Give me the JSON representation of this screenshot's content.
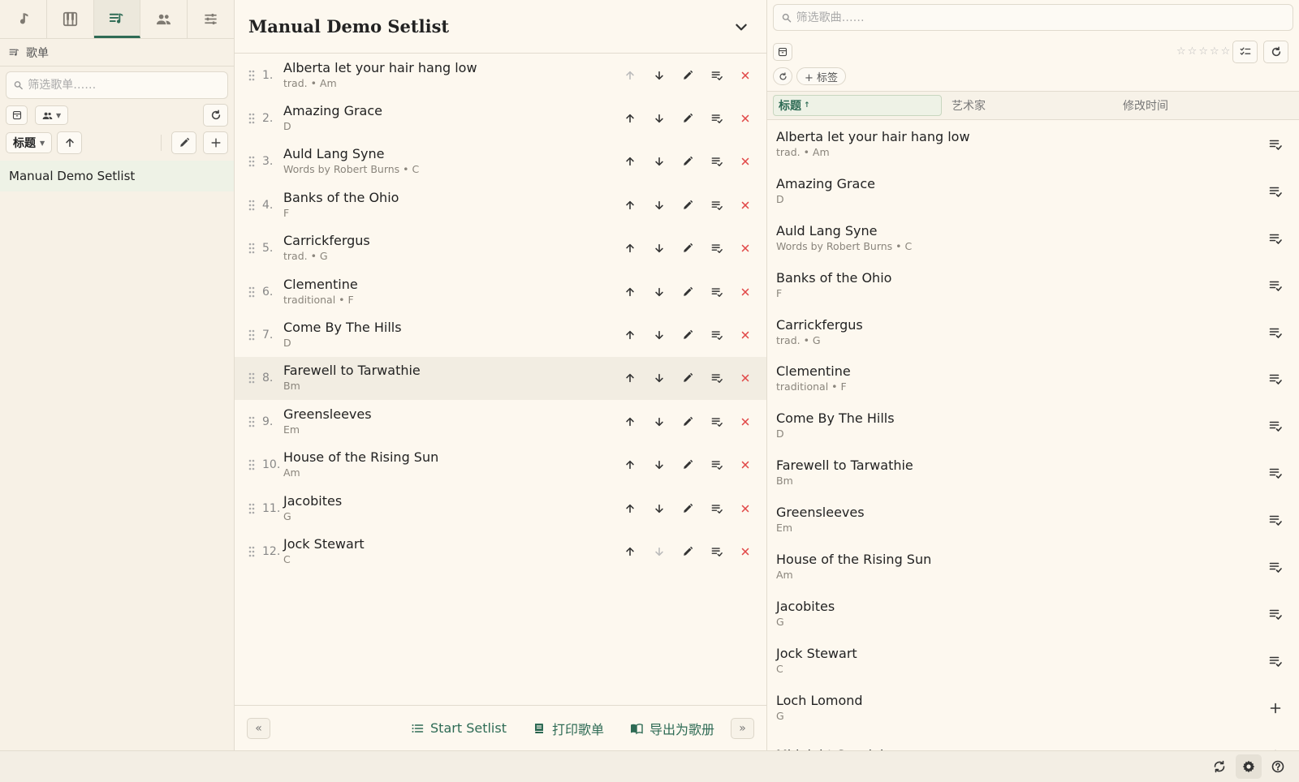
{
  "left": {
    "mode_tabs": [
      {
        "name": "songs",
        "icon": "music-note-icon",
        "active": false
      },
      {
        "name": "chords",
        "icon": "piano-icon",
        "active": false
      },
      {
        "name": "setlists",
        "icon": "playlist-icon",
        "active": true
      },
      {
        "name": "artists",
        "icon": "people-icon",
        "active": false
      },
      {
        "name": "settings",
        "icon": "sliders-icon",
        "active": false
      }
    ],
    "title": "歌单",
    "search_placeholder": "筛选歌单……",
    "sort_label": "标题",
    "setlists": [
      "Manual Demo Setlist"
    ]
  },
  "middle": {
    "title": "Manual Demo Setlist",
    "songs": [
      {
        "num": "1.",
        "title": "Alberta let your hair hang low",
        "sub": "trad. • Am"
      },
      {
        "num": "2.",
        "title": "Amazing Grace",
        "sub": "D"
      },
      {
        "num": "3.",
        "title": "Auld Lang Syne",
        "sub": "Words by Robert Burns • C"
      },
      {
        "num": "4.",
        "title": "Banks of the Ohio",
        "sub": "F"
      },
      {
        "num": "5.",
        "title": "Carrickfergus",
        "sub": "trad. • G"
      },
      {
        "num": "6.",
        "title": "Clementine",
        "sub": "traditional • F"
      },
      {
        "num": "7.",
        "title": "Come By The Hills",
        "sub": "D"
      },
      {
        "num": "8.",
        "title": "Farewell to Tarwathie",
        "sub": "Bm"
      },
      {
        "num": "9.",
        "title": "Greensleeves",
        "sub": "Em"
      },
      {
        "num": "10.",
        "title": "House of the Rising Sun",
        "sub": "Am"
      },
      {
        "num": "11.",
        "title": "Jacobites",
        "sub": "G"
      },
      {
        "num": "12.",
        "title": "Jock Stewart",
        "sub": "C"
      }
    ],
    "footer": {
      "prev": "«",
      "next": "»",
      "start": "Start Setlist",
      "print": "打印歌单",
      "export": "导出为歌册"
    }
  },
  "right": {
    "search_placeholder": "筛选歌曲……",
    "tag_label": "+ 标签",
    "columns": {
      "title": "标题",
      "title_arrow": "↑",
      "artist": "艺术家",
      "modified": "修改时间"
    },
    "songs": [
      {
        "title": "Alberta let your hair hang low",
        "sub": "trad. • Am",
        "in_setlist": true
      },
      {
        "title": "Amazing Grace",
        "sub": "D",
        "in_setlist": true
      },
      {
        "title": "Auld Lang Syne",
        "sub": "Words by Robert Burns • C",
        "in_setlist": true
      },
      {
        "title": "Banks of the Ohio",
        "sub": "F",
        "in_setlist": true
      },
      {
        "title": "Carrickfergus",
        "sub": "trad. • G",
        "in_setlist": true
      },
      {
        "title": "Clementine",
        "sub": "traditional • F",
        "in_setlist": true
      },
      {
        "title": "Come By The Hills",
        "sub": "D",
        "in_setlist": true
      },
      {
        "title": "Farewell to Tarwathie",
        "sub": "Bm",
        "in_setlist": true
      },
      {
        "title": "Greensleeves",
        "sub": "Em",
        "in_setlist": true
      },
      {
        "title": "House of the Rising Sun",
        "sub": "Am",
        "in_setlist": true
      },
      {
        "title": "Jacobites",
        "sub": "G",
        "in_setlist": true
      },
      {
        "title": "Jock Stewart",
        "sub": "C",
        "in_setlist": true
      },
      {
        "title": "Loch Lomond",
        "sub": "G",
        "in_setlist": false
      },
      {
        "title": "Midnight Special",
        "sub": "",
        "in_setlist": false
      }
    ]
  },
  "colors": {
    "accent": "#2e6b55",
    "danger": "#e14848",
    "background": "#fdf8ef"
  }
}
